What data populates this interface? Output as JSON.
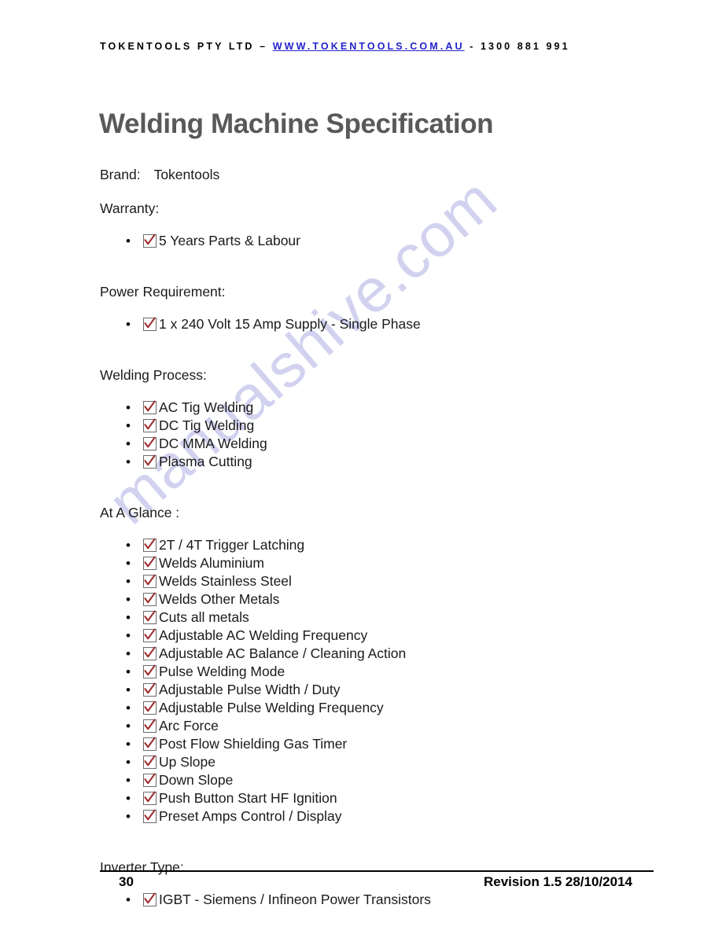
{
  "header": {
    "company": "TOKENTOOLS PTY LTD",
    "dash_before_url": "–",
    "url": "WWW.TOKENTOOLS.COM.AU",
    "phone_separator": "-",
    "phone": "1300 881 991",
    "url_color": "#2222cc"
  },
  "title": "Welding Machine Specification",
  "watermark": {
    "text": "manualshive.com",
    "color": "#d2d2f0"
  },
  "brand": {
    "label": "Brand:",
    "value": "Tokentools"
  },
  "sections": [
    {
      "heading": "Warranty:",
      "items": [
        "5 Years Parts & Labour"
      ]
    },
    {
      "heading": "Power Requirement:",
      "items": [
        "1 x 240 Volt 15 Amp Supply - Single Phase"
      ]
    },
    {
      "heading": "Welding Process:",
      "items": [
        "AC Tig Welding",
        "DC Tig Welding",
        "DC MMA Welding",
        "Plasma Cutting"
      ]
    },
    {
      "heading": "At A Glance :",
      "items": [
        "2T / 4T Trigger Latching",
        "Welds Aluminium",
        "Welds Stainless Steel",
        "Welds Other Metals",
        "Cuts all metals",
        "Adjustable AC Welding Frequency",
        "Adjustable AC Balance / Cleaning Action",
        "Pulse Welding Mode",
        "Adjustable Pulse Width / Duty",
        "Adjustable Pulse Welding Frequency",
        "Arc Force",
        "Post Flow Shielding Gas Timer",
        "Up Slope",
        "Down Slope",
        "Push Button Start HF Ignition",
        "Preset Amps Control / Display"
      ]
    },
    {
      "heading": "Inverter Type:",
      "items": [
        "IGBT - Siemens / Infineon Power Transistors"
      ]
    }
  ],
  "bullet_glyph": "•",
  "checkbox_icon": "checkbox-checked-icon",
  "checkbox_check_color": "#9e2f2f",
  "footer": {
    "page_number": "30",
    "revision": "Revision 1.5 28/10/2014"
  }
}
